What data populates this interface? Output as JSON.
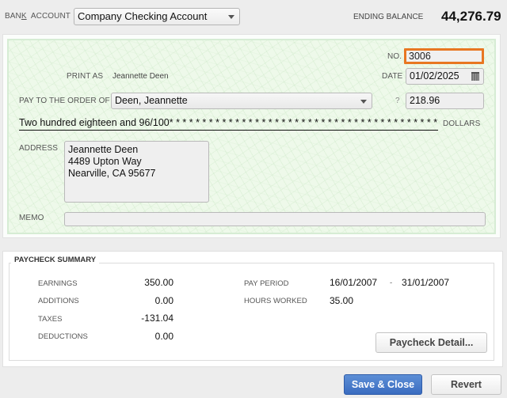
{
  "header": {
    "bank_label_pre": "BAN",
    "bank_label_mnemonic": "K",
    "bank_label_post": "  ACCOUNT",
    "bank_account": "Company Checking Account",
    "ending_balance_label": "ENDING BALANCE",
    "ending_balance": "44,276.79"
  },
  "check": {
    "no_label": "NO.",
    "no_value": "3006",
    "print_as_label": "PRINT AS",
    "print_as_value": "Jeannette Deen",
    "date_label": "DATE",
    "date_value": "01/02/2025",
    "pay_to_label": "PAY TO THE ORDER OF",
    "payee": "Deen, Jeannette",
    "amount_label": "?",
    "amount": "218.96",
    "amount_words": "Two hundred eighteen and 96/100* * * * * * * * * * * * * * * * * * * * * * * * * * * * * * * * * * * * * * * * * * * * * *",
    "dollars_label": "DOLLARS",
    "address_label": "ADDRESS",
    "address": "Jeannette Deen\n4489 Upton Way\nNearville, CA 95677",
    "memo_label": "MEMO",
    "memo_value": ""
  },
  "summary": {
    "title": "PAYCHECK SUMMARY",
    "rows": [
      {
        "label": "EARNINGS",
        "value": "350.00"
      },
      {
        "label": "ADDITIONS",
        "value": "0.00"
      },
      {
        "label": "TAXES",
        "value": "-131.04"
      },
      {
        "label": "DEDUCTIONS",
        "value": "0.00"
      }
    ],
    "pay_period_label": "PAY PERIOD",
    "pay_period_from": "16/01/2007",
    "pay_period_sep": "-",
    "pay_period_to": "31/01/2007",
    "hours_label": "HOURS WORKED",
    "hours_value": "35.00",
    "detail_button": "Paycheck Detail..."
  },
  "footer": {
    "save_close": "Save & Close",
    "revert": "Revert"
  },
  "colors": {
    "focus_border": "#e87722",
    "primary_button": "#3a6cc0",
    "check_background": "#eef9ea"
  }
}
